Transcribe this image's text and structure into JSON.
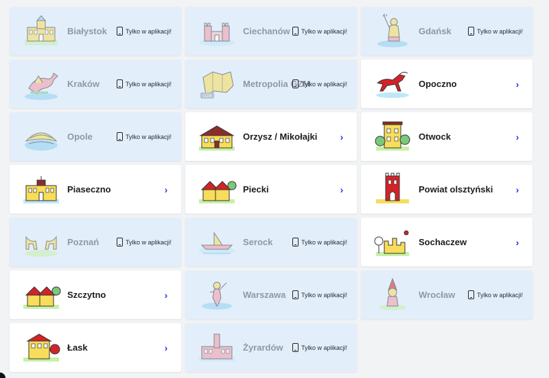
{
  "badge_text": "Tylko w aplikacji!",
  "chevron": "›",
  "colors": {
    "app_card": "#e3eefb",
    "active_card": "#ffffff",
    "chevron": "#1f3bd6"
  },
  "cities": [
    {
      "name": "Białystok",
      "state": "app",
      "icon": "palace-icon"
    },
    {
      "name": "Ciechanów",
      "state": "app",
      "icon": "castle-icon"
    },
    {
      "name": "Gdańsk",
      "state": "app",
      "icon": "neptune-icon"
    },
    {
      "name": "Kraków",
      "state": "app",
      "icon": "dragon-icon"
    },
    {
      "name": "Metropolia GZM",
      "state": "app",
      "icon": "map-icon"
    },
    {
      "name": "Opoczno",
      "state": "active",
      "icon": "horse-icon"
    },
    {
      "name": "Opole",
      "state": "app",
      "icon": "amphitheater-icon"
    },
    {
      "name": "Orzysz / Mikołajki",
      "state": "active",
      "icon": "manor-icon"
    },
    {
      "name": "Otwock",
      "state": "active",
      "icon": "villa-icon"
    },
    {
      "name": "Piaseczno",
      "state": "active",
      "icon": "town-hall-icon"
    },
    {
      "name": "Piecki",
      "state": "active",
      "icon": "house-icon"
    },
    {
      "name": "Powiat olsztyński",
      "state": "active",
      "icon": "gate-tower-icon"
    },
    {
      "name": "Poznań",
      "state": "app",
      "icon": "goats-icon"
    },
    {
      "name": "Serock",
      "state": "app",
      "icon": "boat-icon"
    },
    {
      "name": "Sochaczew",
      "state": "active",
      "icon": "ruins-icon"
    },
    {
      "name": "Szczytno",
      "state": "active",
      "icon": "house-icon"
    },
    {
      "name": "Warszawa",
      "state": "app",
      "icon": "mermaid-icon"
    },
    {
      "name": "Wrocław",
      "state": "app",
      "icon": "dwarf-icon"
    },
    {
      "name": "Łask",
      "state": "active",
      "icon": "tower-house-icon"
    },
    {
      "name": "Żyrardów",
      "state": "app",
      "icon": "factory-icon"
    }
  ]
}
